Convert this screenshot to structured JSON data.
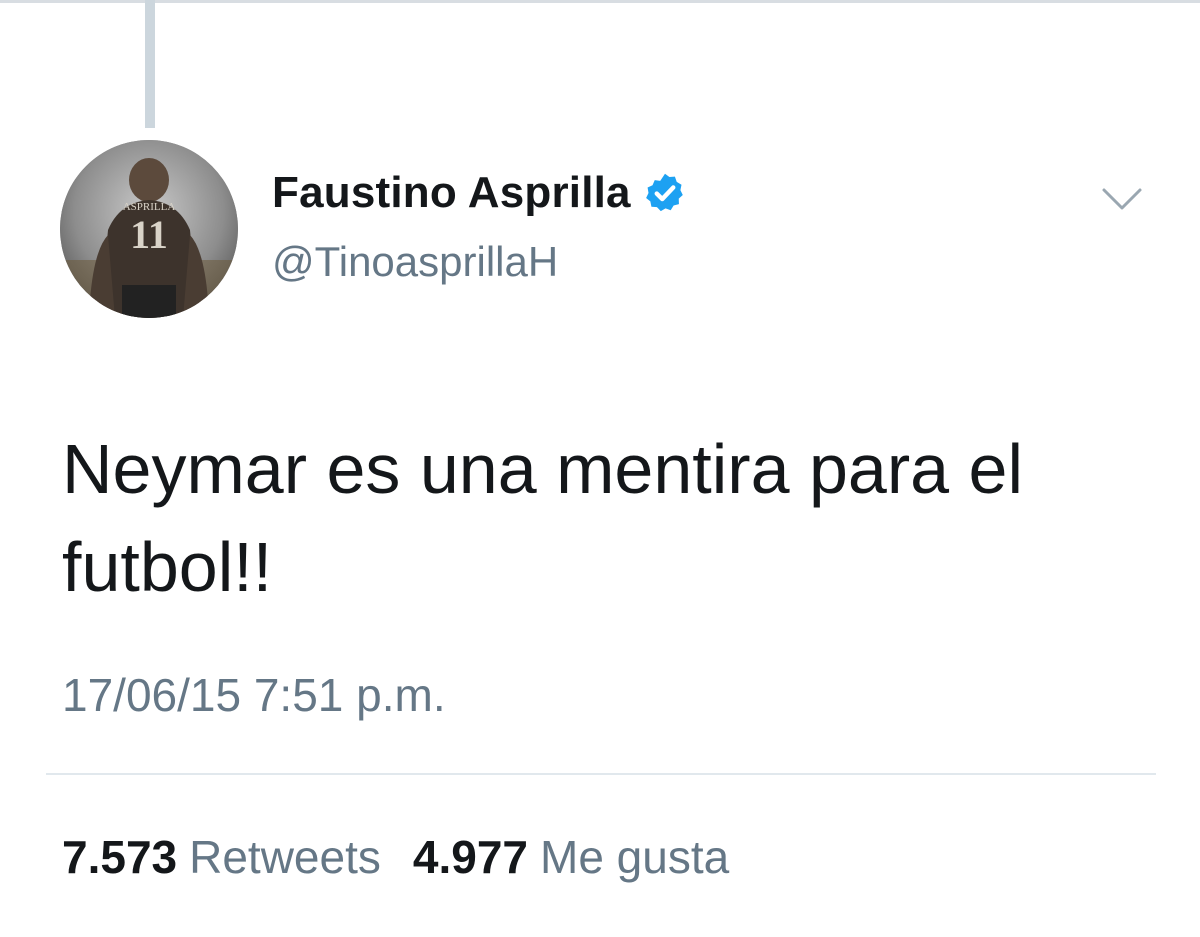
{
  "tweet": {
    "author": {
      "display_name": "Faustino Asprilla",
      "handle": "@TinoasprillaH",
      "verified": true,
      "avatar_jersey_number": "11",
      "avatar_jersey_name": "ASPRILLA"
    },
    "text": "Neymar es una mentira para el futbol!!",
    "timestamp": "17/06/15 7:51 p.m.",
    "stats": {
      "retweets_count": "7.573",
      "retweets_label": "Retweets",
      "likes_count": "4.977",
      "likes_label": "Me gusta"
    }
  },
  "icons": {
    "verified": "verified-badge-icon",
    "menu": "chevron-down-icon"
  },
  "colors": {
    "verified_blue": "#1da1f2",
    "text_primary": "#14171a",
    "text_secondary": "#657786",
    "divider": "#e1e8ed",
    "thread_line": "#ccd6dd"
  }
}
